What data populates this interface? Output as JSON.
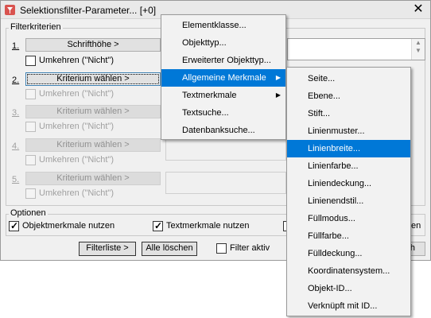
{
  "window": {
    "title": "Selektionsfilter-Parameter... [+0]",
    "close_glyph": "✕"
  },
  "criteria": {
    "group_label": "Filterkriterien",
    "rows": [
      {
        "num": "1.",
        "button": "Schrifthöhe >",
        "invert": "Umkehren (\"Nicht\")"
      },
      {
        "num": "2.",
        "button": "Kriterium wählen >",
        "invert": "Umkehren (\"Nicht\")"
      },
      {
        "num": "3.",
        "button": "Kriterium wählen >",
        "invert": "Umkehren (\"Nicht\")"
      },
      {
        "num": "4.",
        "button": "Kriterium wählen >",
        "invert": "Umkehren (\"Nicht\")"
      },
      {
        "num": "5.",
        "button": "Kriterium wählen >",
        "invert": "Umkehren (\"Nicht\")"
      }
    ]
  },
  "options": {
    "group_label": "Optionen",
    "object_features": "Objektmerkmale nutzen",
    "text_features": "Textmerkmale nutzen",
    "partial_text": "en"
  },
  "bottom": {
    "filter_list": "Filterliste >",
    "clear_all": "Alle löschen",
    "filter_active": "Filter aktiv",
    "partial_button": "h"
  },
  "menu1": {
    "items": [
      "Elementklasse...",
      "Objekttyp...",
      "Erweiterter Objekttyp...",
      "Allgemeine Merkmale",
      "Textmerkmale",
      "Textsuche...",
      "Datenbanksuche..."
    ]
  },
  "menu2": {
    "items": [
      "Seite...",
      "Ebene...",
      "Stift...",
      "Linienmuster...",
      "Linienbreite...",
      "Linienfarbe...",
      "Liniendeckung...",
      "Linienendstil...",
      "Füllmodus...",
      "Füllfarbe...",
      "Fülldeckung...",
      "Koordinatensystem...",
      "Objekt-ID...",
      "Verknüpft mit ID..."
    ]
  },
  "colors": {
    "selection": "#0078d7",
    "dialog_bg": "#f0f0f0",
    "menu_bg": "#f2f2f2"
  }
}
